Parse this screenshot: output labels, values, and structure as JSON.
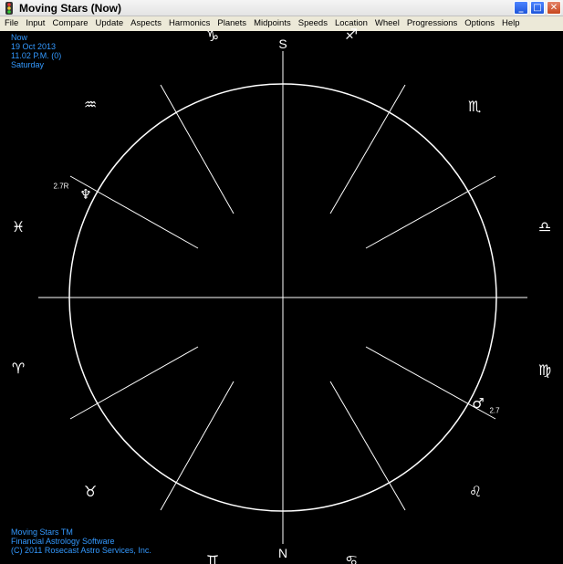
{
  "window": {
    "title": "Moving Stars (Now)"
  },
  "menu": [
    "File",
    "Input",
    "Compare",
    "Update",
    "Aspects",
    "Harmonics",
    "Planets",
    "Midpoints",
    "Speeds",
    "Location",
    "Wheel",
    "Progressions",
    "Options",
    "Help"
  ],
  "info_top": {
    "line1": "Now",
    "line2": "19 Oct 2013",
    "line3": "11.02 P.M. (0)",
    "line4": "Saturday"
  },
  "info_bottom": {
    "line1": "Moving Stars TM",
    "line2": "Financial Astrology Software",
    "line3": "(C) 2011 Rosecast Astro Services, Inc."
  },
  "directions": {
    "top": "S",
    "bottom": "N"
  },
  "zodiac": {
    "capricorn": "♑",
    "sagittarius": "♐",
    "aquarius": "♒",
    "scorpio": "♏",
    "pisces": "♓",
    "libra": "♎",
    "aries": "♈",
    "virgo": "♍",
    "taurus": "♉",
    "leo": "♌",
    "gemini": "♊",
    "cancer": "♋"
  },
  "planets": {
    "neptune": {
      "symbol": "♆",
      "degree": "2.7R"
    },
    "mars": {
      "symbol": "♂",
      "degree": "2.7"
    }
  },
  "colors": {
    "background": "#000000",
    "info_text": "#3399ff",
    "lines": "#ffffff"
  }
}
